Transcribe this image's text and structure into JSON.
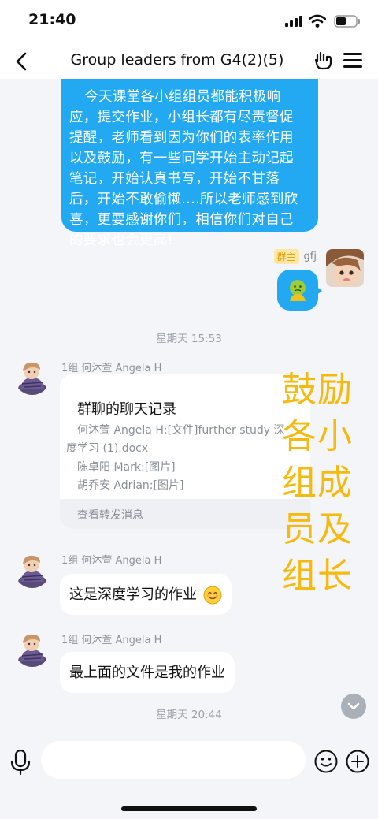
{
  "status_bar": {
    "time": "21:40"
  },
  "header": {
    "title": "Group leaders from G4(2)(5)"
  },
  "messages": {
    "outgoing_text": "今天课堂各小组组员都能积极响应，提交作业，小组长都有尽责督促提醒，老师看到因为你们的表率作用以及鼓励，有一些同学开始主动记起笔记，开始认真书写，开始不甘落后，开始不敢偷懒....所以老师感到欣喜，更要感谢你们，相信你们对自己的要求也会更高!",
    "self_badge": "群主",
    "self_name": "gfj",
    "time_1": "星期天 15:53",
    "sender_1": "1组 何沐萱 Angela H",
    "forward": {
      "title": "群聊的聊天记录",
      "line_1a": "何沐萱 Angela H:[文件]further study 深",
      "line_1b": "度学习 (1).docx",
      "line_2": "陈卓阳 Mark:[图片]",
      "line_3": "胡乔安 Adrian:[图片]",
      "footer": "查看转发消息"
    },
    "sender_2": "1组 何沐萱 Angela H",
    "bubble_2": "这是深度学习的作业",
    "sender_3": "1组 何沐萱 Angela H",
    "bubble_3": "最上面的文件是我的作业",
    "time_2": "星期天 20:44"
  },
  "overlay": {
    "line_1": "鼓励",
    "line_2": "各小",
    "line_3": "组成",
    "line_4": "员及",
    "line_5": "组长"
  },
  "input": {
    "placeholder": ""
  },
  "colors": {
    "accent": "#22a9f2",
    "overlay": "#f6b90d",
    "background": "#f4f5f8"
  },
  "icons": [
    "back-icon",
    "gesture-icon",
    "menu-icon",
    "voice-icon",
    "emoji-icon",
    "plus-icon",
    "chevron-down-icon"
  ]
}
